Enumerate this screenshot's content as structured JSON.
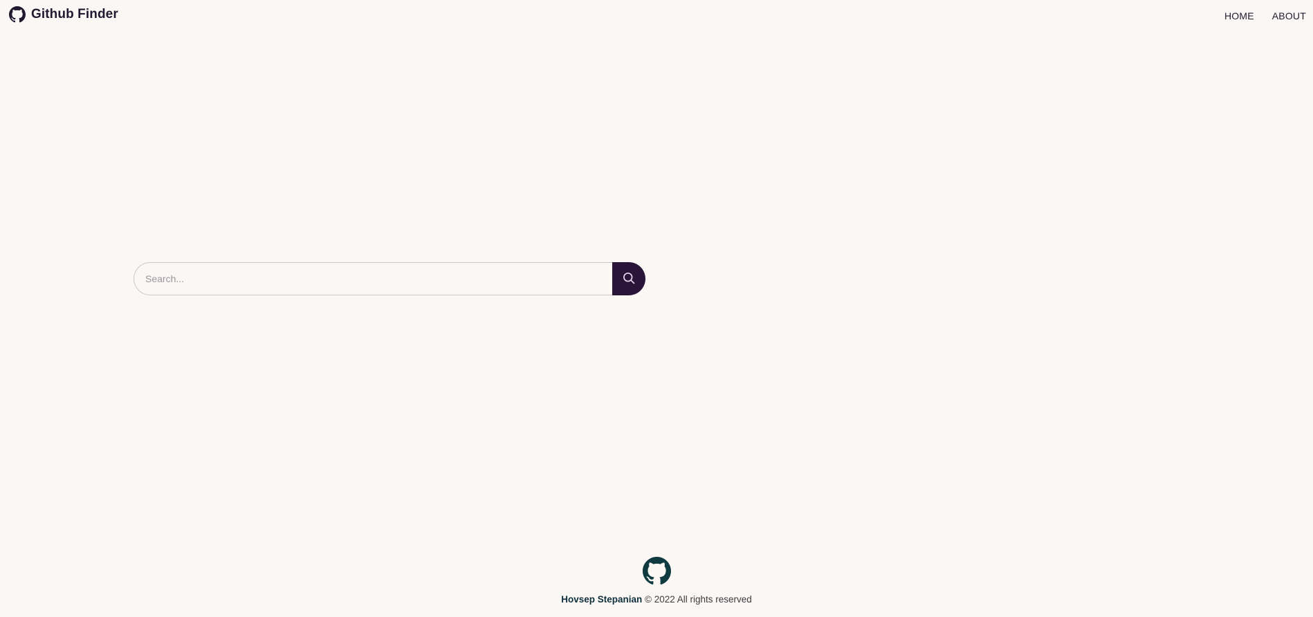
{
  "navbar": {
    "brand": {
      "icon": "github-icon",
      "title": "Github Finder"
    },
    "links": [
      {
        "label": "HOME"
      },
      {
        "label": "ABOUT"
      }
    ]
  },
  "search": {
    "placeholder": "Search...",
    "value": "",
    "button_icon": "search-icon"
  },
  "footer": {
    "icon": "github-icon",
    "author": "Hovsep Stepanian",
    "rights": "© 2022 All rights reserved"
  },
  "colors": {
    "background": "#faf7f5",
    "primary": "#2a1538",
    "footer_icon": "#0e3a40"
  }
}
